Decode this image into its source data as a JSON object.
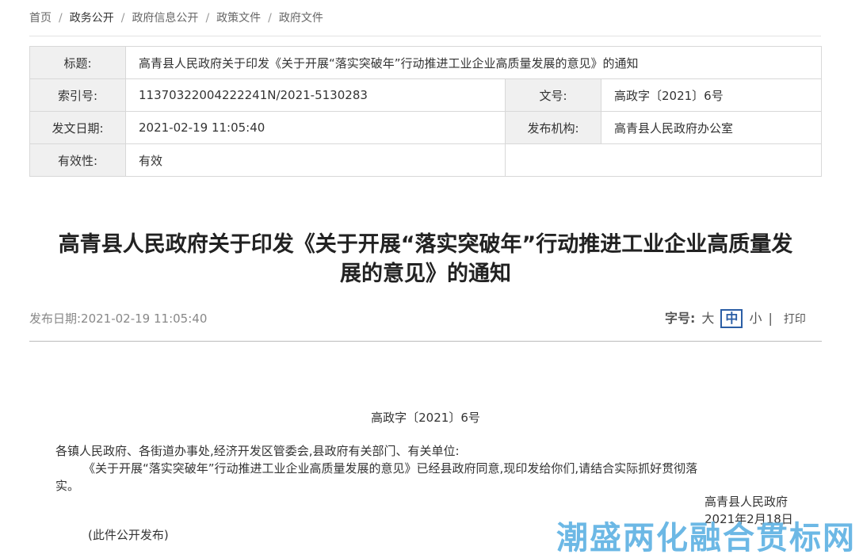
{
  "breadcrumb": [
    "首页",
    "政务公开",
    "政府信息公开",
    "政策文件",
    "政府文件"
  ],
  "meta": {
    "title_label": "标题:",
    "title_value": "高青县人民政府关于印发《关于开展“落实突破年”行动推进工业企业高质量发展的意见》的通知",
    "index_label": "索引号:",
    "index_value": "11370322004222241N/2021-5130283",
    "docno_label": "文号:",
    "docno_value": "高政字〔2021〕6号",
    "date_label": "发文日期:",
    "date_value": "2021-02-19 11:05:40",
    "org_label": "发布机构:",
    "org_value": "高青县人民政府办公室",
    "validity_label": "有效性:",
    "validity_value": "有效"
  },
  "article": {
    "title_line1": "高青县人民政府关于印发《关于开展“落实突破年”行动推进工业企业高质量发",
    "title_line2": "展的意见》的通知",
    "pubdate": "发布日期:2021-02-19 11:05:40",
    "fontsize_label": "字号:",
    "fontsize_large": "大",
    "fontsize_medium": "中",
    "fontsize_small": "小",
    "separator": "|",
    "print_label": "打印",
    "doc_number": "高政字〔2021〕6号",
    "recipients": "各镇人民政府、各街道办事处,经济开发区管委会,县政府有关部门、有关单位:",
    "body_line1": "《关于开展“落实突破年”行动推进工业企业高质量发展的意见》已经县政府同意,现印发给你们,请结合实际抓好贯彻落",
    "body_line2": "实。",
    "signer": "高青县人民政府",
    "sign_date": "2021年2月18日",
    "note": "(此件公开发布)"
  },
  "watermark": "潮盛两化融合贯标网"
}
